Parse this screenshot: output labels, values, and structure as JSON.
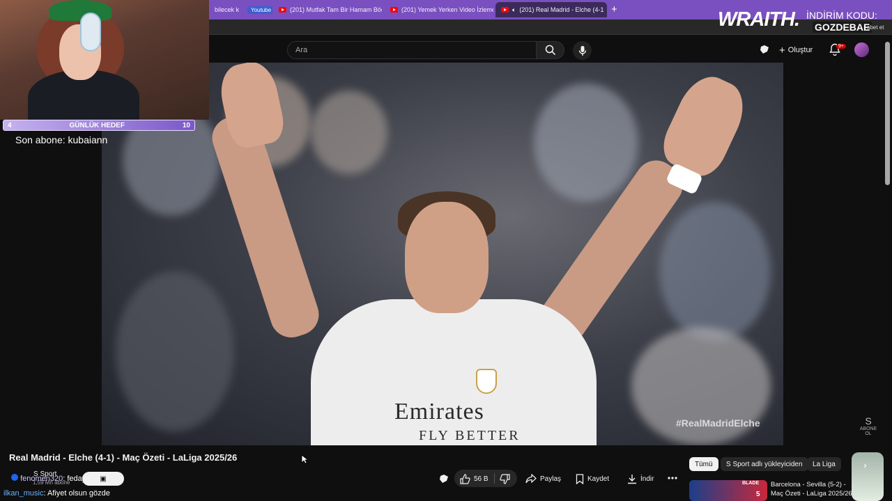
{
  "browser": {
    "tabs": [
      {
        "label": "bilecek k",
        "active": false
      },
      {
        "label": "(201) Mutfak Tam Bir Hamam Böc",
        "active": false
      },
      {
        "label": "(201) Yemek Yerken Video İzlemek",
        "active": false
      },
      {
        "label": "(201) Real Madrid - Elche (4-1",
        "active": true
      }
    ],
    "tab_group": "Youtube"
  },
  "youtube": {
    "search_placeholder": "Ara",
    "create_label": "Oluştur",
    "notif_count": "9+",
    "video_hashtag": "#RealMadridElche",
    "sponsor_shirt_top": "Emirates",
    "sponsor_shirt_bottom": "FLY BETTER",
    "watermark": "ABONE OL",
    "video_title": "Real Madrid - Elche (4-1) - Maç Özeti - LaLiga 2025/26",
    "channel_name": "S Sport",
    "subscriber_count": "1,59 Mn abone",
    "actions": {
      "like_count": "56 B",
      "share": "Paylaş",
      "save": "Kaydet",
      "download": "İndir"
    },
    "chips": [
      "Tümü",
      "S Sport adlı yükleyiciden",
      "La Liga"
    ],
    "recommended": {
      "title": "Barcelona - Sevilla (5-2) - Maç Özeti - LaLiga 2025/26",
      "thumb_brand": "BLADE",
      "thumb_score": "5"
    }
  },
  "stream_overlay": {
    "goal_start": "4",
    "goal_label": "GÜNLÜK HEDEF",
    "goal_end": "10",
    "last_sub": "Son abone: kubaiann",
    "brand": "WRAITH.",
    "promo_line1": "İNDİRİM KODU:",
    "promo_code": "GOZDEBAE",
    "promo_small": "abet et"
  },
  "chat": [
    {
      "user": "fenomen320",
      "message": ": fedayardı"
    },
    {
      "user": "ilkan_music",
      "message": ": Afiyet olsun gözde"
    }
  ],
  "colors": {
    "tabstrip": "#7a4fbf",
    "youtube_bg": "#0f0f0f",
    "accent_red": "#ff0000"
  }
}
